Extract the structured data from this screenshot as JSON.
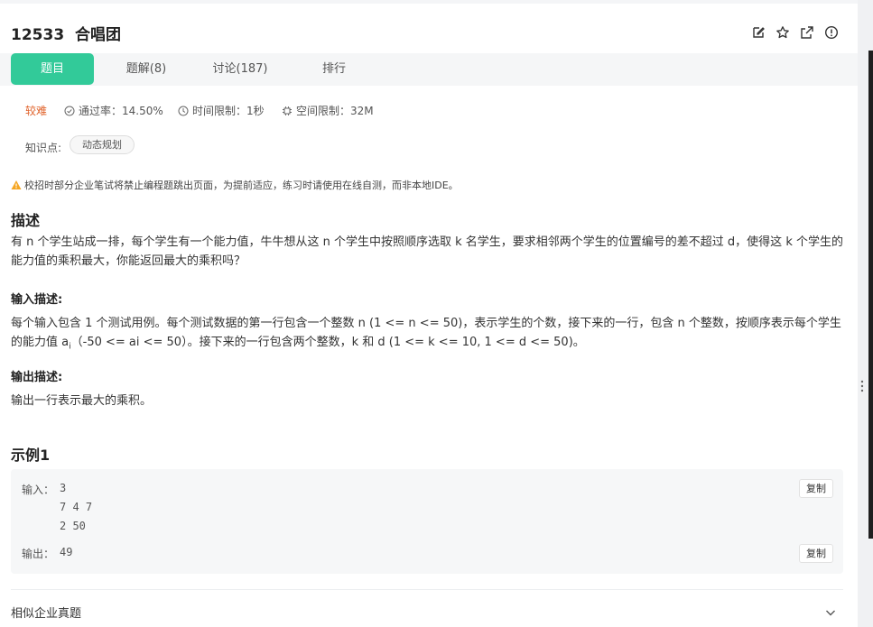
{
  "problem": {
    "id": "12533",
    "name": "合唱团"
  },
  "tabs": [
    {
      "label": "题目",
      "active": true
    },
    {
      "label": "题解(8)",
      "active": false
    },
    {
      "label": "讨论(187)",
      "active": false
    },
    {
      "label": "排行",
      "active": false
    }
  ],
  "meta": {
    "difficulty": "较难",
    "pass_rate": "通过率：14.50%",
    "time_limit": "时间限制：1秒",
    "space_limit": "空间限制：32M"
  },
  "knowledge": {
    "label": "知识点:",
    "tag": "动态规划"
  },
  "warning": "校招时部分企业笔试将禁止编程题跳出页面，为提前适应，练习时请使用在线自测，而非本地IDE。",
  "description": {
    "heading": "描述",
    "text": "有 n 个学生站成一排，每个学生有一个能力值，牛牛想从这 n 个学生中按照顺序选取 k 名学生，要求相邻两个学生的位置编号的差不超过 d，使得这 k 个学生的能力值的乘积最大，你能返回最大的乘积吗？"
  },
  "input_desc": {
    "heading": "输入描述:",
    "text_before": "每个输入包含 1 个测试用例。每个测试数据的第一行包含一个整数 n (1 <= n <= 50)，表示学生的个数，接下来的一行，包含 n 个整数，按顺序表示每个学生的能力值 a",
    "subscript": "i",
    "text_after": "（-50 <= ai <= 50）。接下来的一行包含两个整数，k 和 d (1 <= k <= 10, 1 <= d <= 50)。"
  },
  "output_desc": {
    "heading": "输出描述:",
    "text": "输出一行表示最大的乘积。"
  },
  "example": {
    "heading": "示例1",
    "input_label": "输入：",
    "input_lines": [
      "3",
      "7 4 7",
      "2 50"
    ],
    "output_label": "输出：",
    "output_value": "49",
    "copy_label": "复制"
  },
  "similar": {
    "label": "相似企业真题"
  },
  "colors": {
    "accent": "#32ca99",
    "difficulty": "#e0622a",
    "warning_icon": "#f5a623"
  }
}
